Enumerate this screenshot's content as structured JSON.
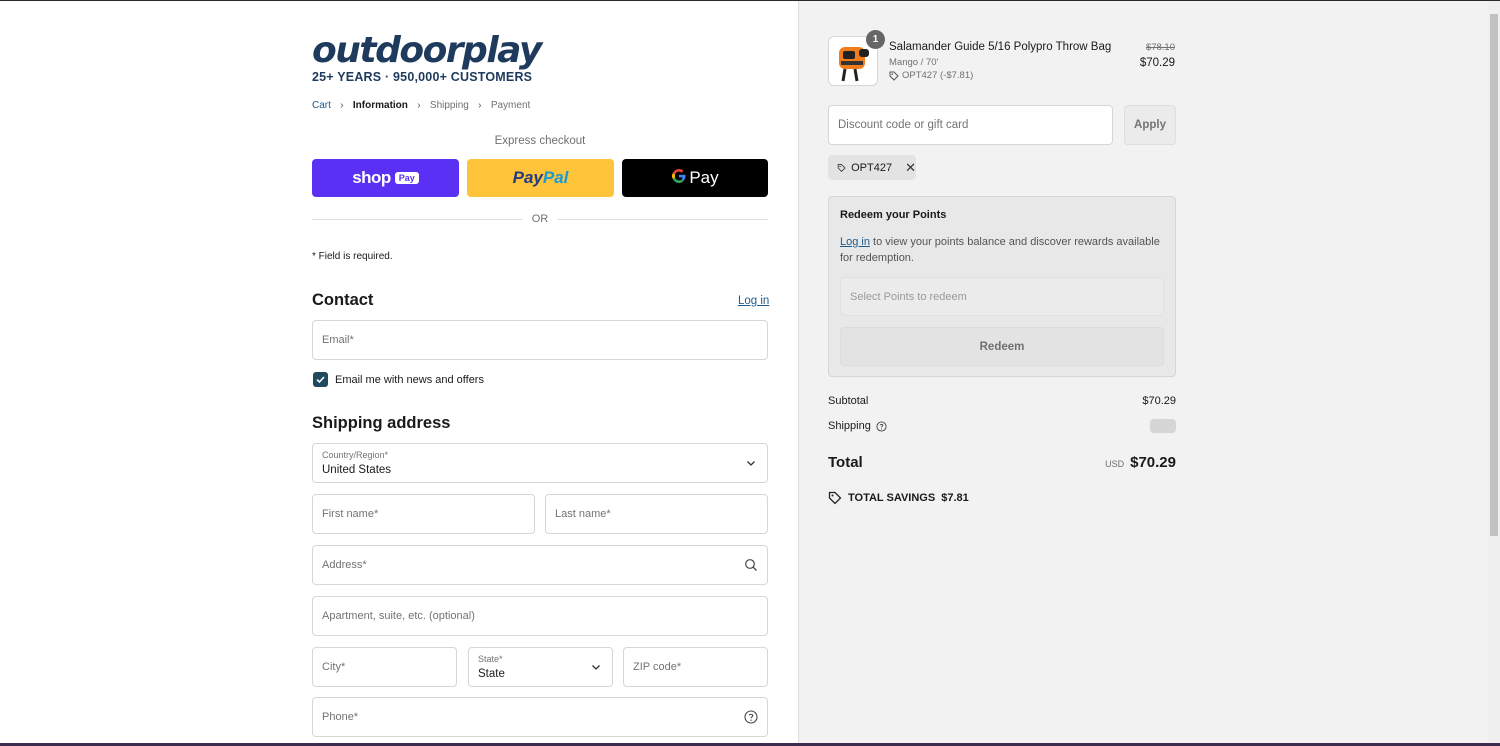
{
  "brand": {
    "name": "outdoorplay",
    "tagline": "25+ YEARS · 950,000+ CUSTOMERS",
    "color": "#1e3a5c"
  },
  "breadcrumb": [
    "Cart",
    "Information",
    "Shipping",
    "Payment"
  ],
  "express": {
    "label": "Express checkout",
    "shop_pay": {
      "word": "shop",
      "badge": "Pay",
      "color": "#5a31f4"
    },
    "paypal": {
      "part1": "Pay",
      "part2": "Pal",
      "color": "#ffc439"
    },
    "gpay": {
      "g": "G",
      "pay": "Pay",
      "color": "#000000"
    },
    "or": "OR"
  },
  "required_note": "* Field is required.",
  "contact": {
    "heading": "Contact",
    "login": "Log in",
    "email_placeholder": "Email*",
    "newsletter_label": "Email me with news and offers",
    "newsletter_checked": true
  },
  "shipping": {
    "heading": "Shipping address",
    "country_label": "Country/Region*",
    "country_value": "United States",
    "first_name": "First name*",
    "last_name": "Last name*",
    "address": "Address*",
    "apartment": "Apartment, suite, etc. (optional)",
    "city": "City*",
    "state_label": "State*",
    "state_value": "State",
    "zip": "ZIP code*",
    "phone": "Phone*"
  },
  "order": {
    "item": {
      "quantity": "1",
      "name": "Salamander Guide 5/16 Polypro Throw Bag",
      "variant": "Mango / 70'",
      "discount": "OPT427 (-$7.81)",
      "price_original": "$78.10",
      "price": "$70.29"
    },
    "discount_placeholder": "Discount code or gift card",
    "apply_label": "Apply",
    "applied_code": "OPT427",
    "redeem": {
      "title": "Redeem your Points",
      "login_link": "Log in",
      "desc": " to view your points balance and discover rewards available for redemption.",
      "select_placeholder": "Select Points to redeem",
      "button": "Redeem"
    },
    "subtotal_label": "Subtotal",
    "subtotal": "$70.29",
    "shipping_label": "Shipping",
    "total_label": "Total",
    "currency": "USD",
    "total": "$70.29",
    "savings_label": "TOTAL SAVINGS",
    "savings": "$7.81"
  }
}
